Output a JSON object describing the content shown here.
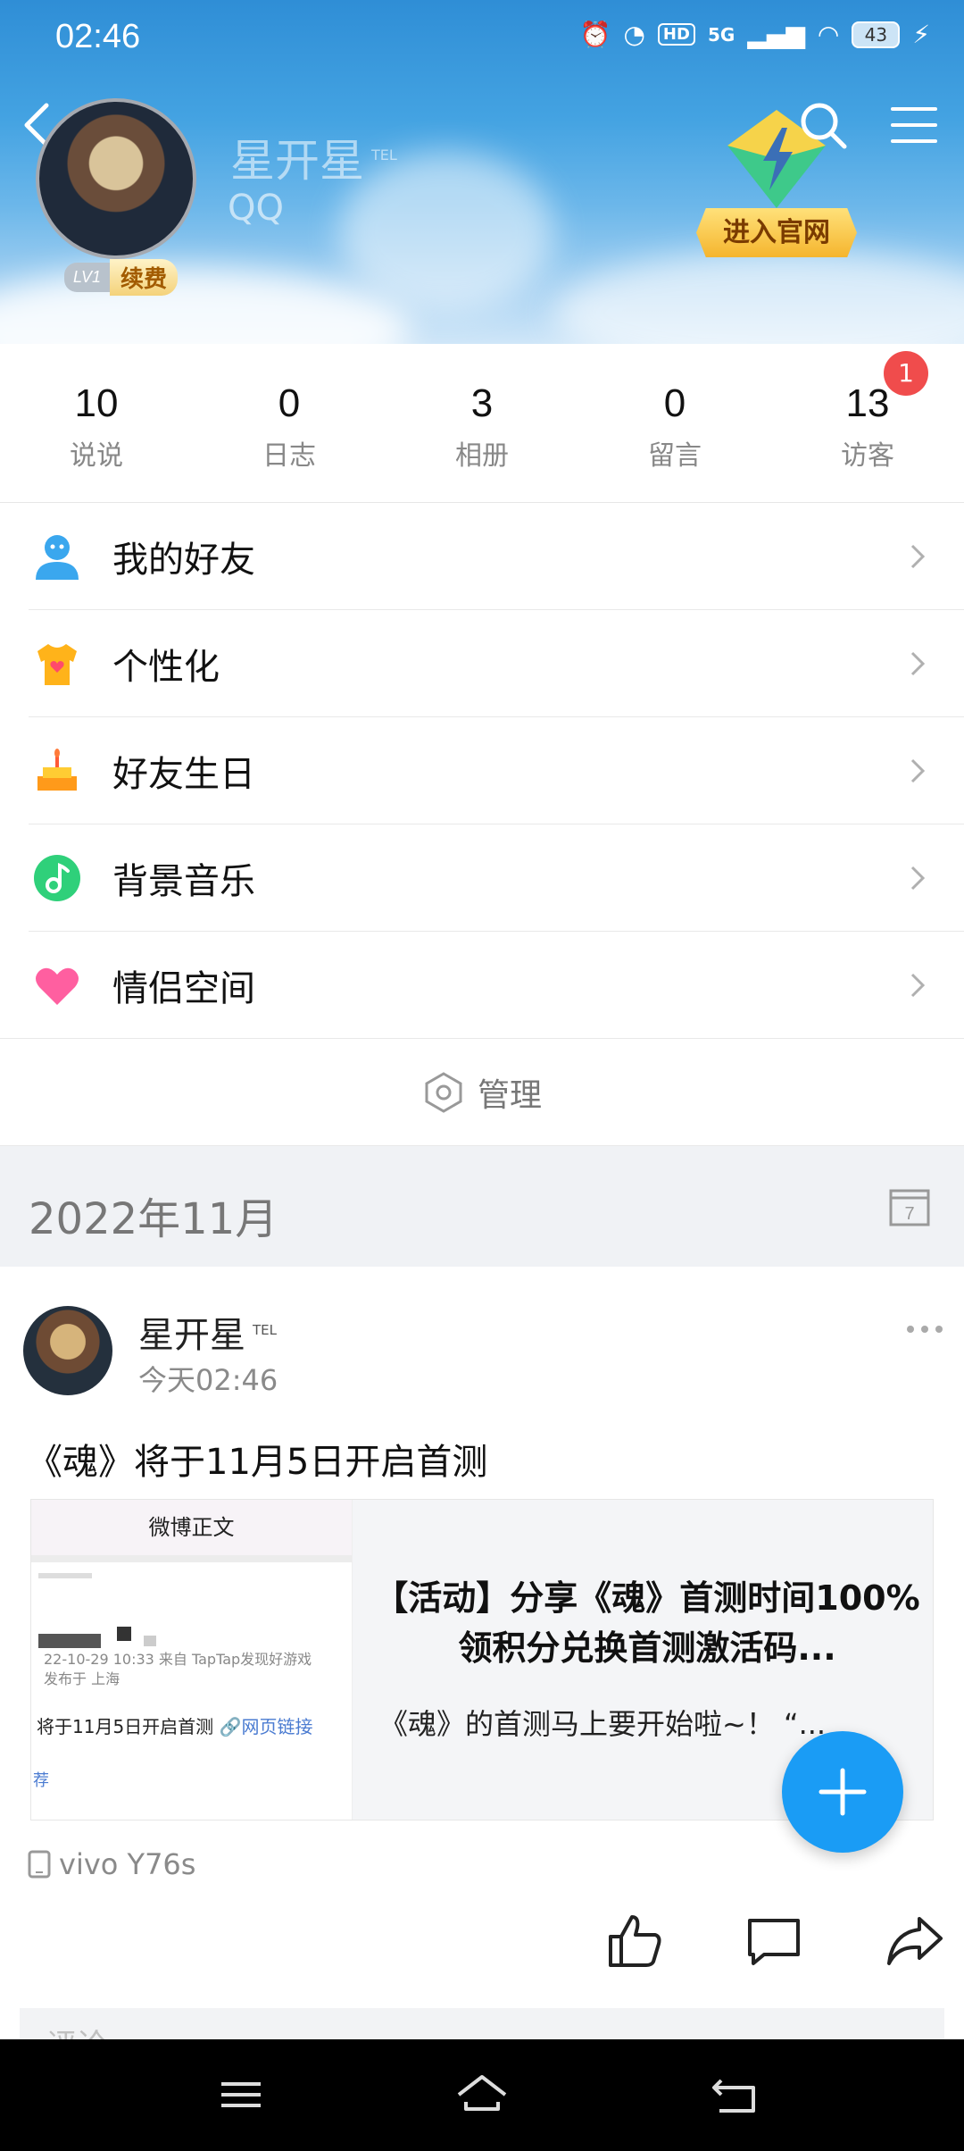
{
  "status_bar": {
    "time": "02:46",
    "network": "5G",
    "hd": "HD",
    "battery": "43"
  },
  "profile": {
    "name": "星开星",
    "name_badge": "TEL",
    "qq_partial": "QQ",
    "level": "LV1",
    "renew_label": "续费",
    "official_button": "进入官网"
  },
  "stats": [
    {
      "value": "10",
      "label": "说说"
    },
    {
      "value": "0",
      "label": "日志"
    },
    {
      "value": "3",
      "label": "相册"
    },
    {
      "value": "0",
      "label": "留言"
    },
    {
      "value": "13",
      "label": "访客",
      "badge": "1"
    }
  ],
  "menu": [
    {
      "label": "我的好友",
      "icon": "friends-icon"
    },
    {
      "label": "个性化",
      "icon": "personalize-icon"
    },
    {
      "label": "好友生日",
      "icon": "birthday-cake-icon"
    },
    {
      "label": "背景音乐",
      "icon": "music-note-icon"
    },
    {
      "label": "情侣空间",
      "icon": "heart-icon"
    }
  ],
  "manage_label": "管理",
  "month_label": "2022年11月",
  "post": {
    "author": "星开星",
    "author_badge": "TEL",
    "time": "今天02:46",
    "text": "《魂》将于11月5日开启首测",
    "link_card": {
      "thumb_title": "微博正文",
      "thumb_meta_1": "22-10-29 10:33  来自 TapTap发现好游戏",
      "thumb_meta_2": "发布于 上海",
      "thumb_text": "将于11月5日开启首测",
      "thumb_link": "🔗网页链接",
      "thumb_rec": "荐",
      "title": "【活动】分享《魂》首测时间100%领积分兑换首测激活码...",
      "desc": "《魂》的首测马上要开始啦~！    “..."
    },
    "device": "vivo  Y76s",
    "comment_placeholder": "评论"
  },
  "colors": {
    "accent": "#1a9cf5",
    "badge_red": "#f04c4c",
    "header_top": "#2f8ed6"
  }
}
